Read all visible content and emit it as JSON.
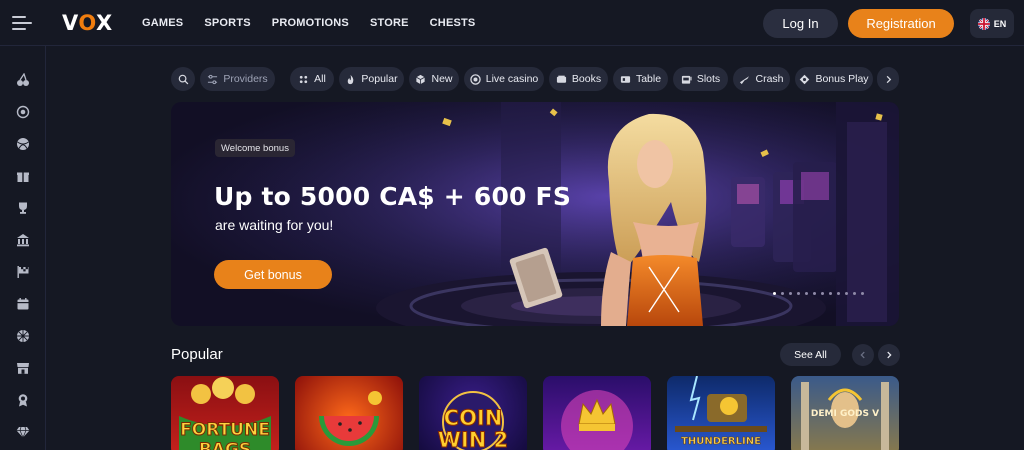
{
  "header": {
    "logo": {
      "text_v": "V",
      "text_o": "O",
      "text_x": "X",
      "accent": "#f07d0e"
    },
    "nav": [
      "GAMES",
      "SPORTS",
      "PROMOTIONS",
      "STORE",
      "CHESTS"
    ],
    "login_label": "Log In",
    "register_label": "Registration",
    "language": {
      "label": "EN",
      "flag": "uk-flag-icon"
    }
  },
  "sidebar": {
    "icons": [
      "cherries-icon",
      "target-icon",
      "ball-icon",
      "gift-icon",
      "trophy-icon",
      "bank-icon",
      "race-flag-icon",
      "calendar-icon",
      "wheel-icon",
      "store-icon",
      "badge-icon",
      "diamond-icon"
    ]
  },
  "filters": {
    "search_icon": "search-icon",
    "providers": "Providers",
    "categories": [
      {
        "label": "All",
        "icon": "dots-icon"
      },
      {
        "label": "Popular",
        "icon": "flame-icon"
      },
      {
        "label": "New",
        "icon": "cube-icon"
      },
      {
        "label": "Live casino",
        "icon": "chip-icon"
      },
      {
        "label": "Books",
        "icon": "book-icon"
      },
      {
        "label": "Table",
        "icon": "cards-icon"
      },
      {
        "label": "Slots",
        "icon": "slot-icon"
      },
      {
        "label": "Crash",
        "icon": "plane-icon"
      },
      {
        "label": "Bonus Play",
        "icon": "bonus-icon"
      }
    ]
  },
  "banner": {
    "badge": "Welcome bonus",
    "title": "Up to 5000 CA$ + 600 FS",
    "subtitle": "are waiting for you!",
    "cta": "Get bonus",
    "slides_total": 12,
    "active_slide": 1
  },
  "popular": {
    "title": "Popular",
    "see_all": "See All",
    "games": [
      {
        "line1": "FORTUNE",
        "line2": "BAGS"
      },
      {
        "line1": "",
        "line2": ""
      },
      {
        "line1": "COIN",
        "line2": "WIN 2"
      },
      {
        "line1": "",
        "line2": ""
      },
      {
        "line1": "THUNDERLINE",
        "line2": ""
      },
      {
        "line1": "DEMI GODS V",
        "line2": ""
      }
    ]
  },
  "colors": {
    "accent": "#e8821a",
    "background": "#151823",
    "surface": "#262a3a"
  }
}
